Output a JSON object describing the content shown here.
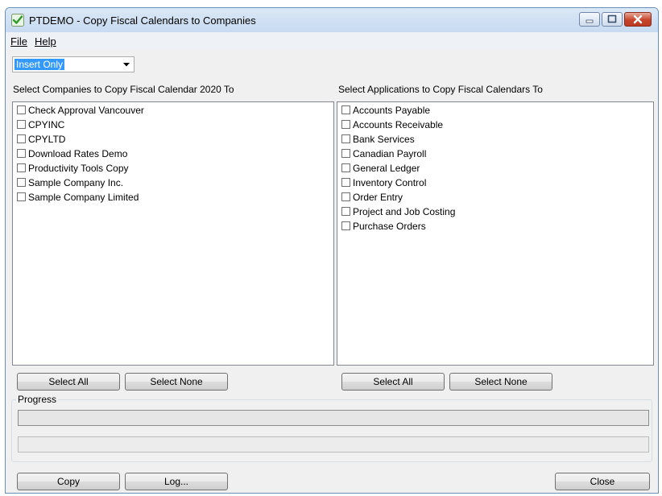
{
  "window": {
    "title": "PTDEMO - Copy Fiscal Calendars to Companies"
  },
  "menu": {
    "file": "File",
    "help": "Help"
  },
  "mode_select": {
    "value": "Insert Only"
  },
  "companies": {
    "label": "Select Companies to Copy Fiscal Calendar 2020 To",
    "items": [
      {
        "label": "Check Approval Vancouver",
        "checked": false
      },
      {
        "label": "CPYINC",
        "checked": false
      },
      {
        "label": "CPYLTD",
        "checked": false
      },
      {
        "label": "Download Rates Demo",
        "checked": false
      },
      {
        "label": "Productivity Tools Copy",
        "checked": false
      },
      {
        "label": "Sample Company Inc.",
        "checked": false
      },
      {
        "label": "Sample Company Limited",
        "checked": false
      }
    ],
    "select_all": "Select All",
    "select_none": "Select None"
  },
  "applications": {
    "label": "Select Applications to Copy Fiscal Calendars To",
    "items": [
      {
        "label": "Accounts Payable",
        "checked": false
      },
      {
        "label": "Accounts Receivable",
        "checked": false
      },
      {
        "label": "Bank Services",
        "checked": false
      },
      {
        "label": "Canadian Payroll",
        "checked": false
      },
      {
        "label": "General Ledger",
        "checked": false
      },
      {
        "label": "Inventory Control",
        "checked": false
      },
      {
        "label": "Order Entry",
        "checked": false
      },
      {
        "label": "Project and Job Costing",
        "checked": false
      },
      {
        "label": "Purchase Orders",
        "checked": false
      }
    ],
    "select_all": "Select All",
    "select_none": "Select None"
  },
  "progress": {
    "legend": "Progress",
    "bar1_value": 0,
    "bar2_value": 0
  },
  "footer": {
    "copy": "Copy",
    "log": "Log...",
    "close": "Close"
  },
  "colors": {
    "selection": "#3399ff",
    "close_button": "#c7432a",
    "title_gradient": "#c7daf0"
  },
  "icons": {
    "app": "app-checkmark-icon",
    "minimize": "minimize-icon",
    "maximize": "maximize-icon",
    "close": "close-icon",
    "dropdown": "chevron-down-icon"
  }
}
